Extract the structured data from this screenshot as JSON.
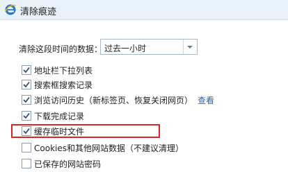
{
  "dialog": {
    "title": "清除痕迹",
    "icon": "ie-logo-icon"
  },
  "time_range": {
    "label": "清除这段时间的数据：",
    "selected": "过去一小时"
  },
  "options": [
    {
      "label": "地址栏下拉列表",
      "checked": true
    },
    {
      "label": "搜索框搜索记录",
      "checked": true
    },
    {
      "label": "浏览访问历史（新标签页、恢复关闭网页）",
      "checked": true
    },
    {
      "label": "下载完成记录",
      "checked": true
    },
    {
      "label": "缓存临时文件",
      "checked": true,
      "highlighted": true
    },
    {
      "label": "Cookies和其他网站数据（不建议清理）",
      "checked": false
    },
    {
      "label": "已保存的网站密码",
      "checked": false
    }
  ],
  "history_link": "查看",
  "colors": {
    "titlebar_bg": "#e9f1f9",
    "highlight": "#d92525",
    "link": "#2b61a8",
    "checkmark": "#2e4f80"
  }
}
